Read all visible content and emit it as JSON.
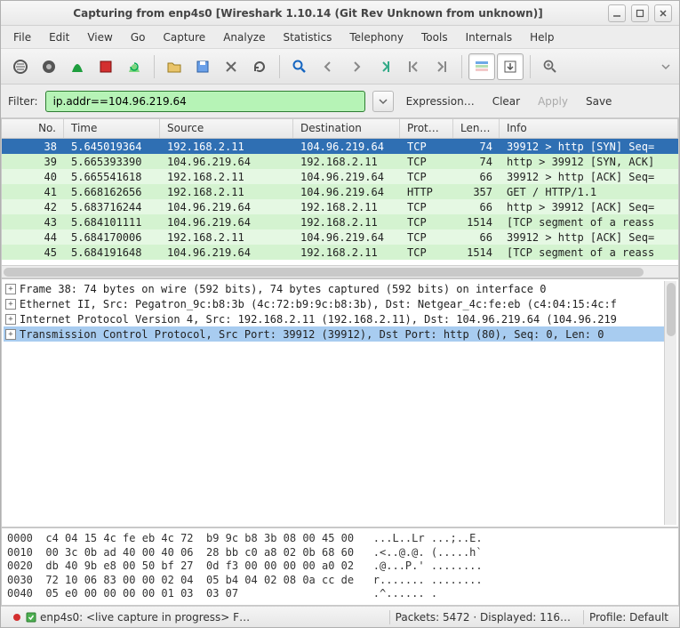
{
  "window": {
    "title": "Capturing from enp4s0   [Wireshark 1.10.14  (Git Rev Unknown from unknown)]"
  },
  "menus": [
    "File",
    "Edit",
    "View",
    "Go",
    "Capture",
    "Analyze",
    "Statistics",
    "Telephony",
    "Tools",
    "Internals",
    "Help"
  ],
  "filter": {
    "label": "Filter:",
    "value": "ip.addr==104.96.219.64",
    "expression": "Expression…",
    "clear": "Clear",
    "apply": "Apply",
    "save": "Save"
  },
  "columns": {
    "no": "No.",
    "time": "Time",
    "src": "Source",
    "dst": "Destination",
    "proto": "Protocol",
    "len": "Length",
    "info": "Info"
  },
  "packets": [
    {
      "no": 38,
      "time": "5.645019364",
      "src": "192.168.2.11",
      "dst": "104.96.219.64",
      "proto": "TCP",
      "len": 74,
      "info": "39912 > http [SYN] Seq=",
      "cls": "sel"
    },
    {
      "no": 39,
      "time": "5.665393390",
      "src": "104.96.219.64",
      "dst": "192.168.2.11",
      "proto": "TCP",
      "len": 74,
      "info": "http > 39912 [SYN, ACK]",
      "cls": "e2"
    },
    {
      "no": 40,
      "time": "5.665541618",
      "src": "192.168.2.11",
      "dst": "104.96.219.64",
      "proto": "TCP",
      "len": 66,
      "info": "39912 > http [ACK] Seq=",
      "cls": "e1"
    },
    {
      "no": 41,
      "time": "5.668162656",
      "src": "192.168.2.11",
      "dst": "104.96.219.64",
      "proto": "HTTP",
      "len": 357,
      "info": "GET / HTTP/1.1",
      "cls": "e2"
    },
    {
      "no": 42,
      "time": "5.683716244",
      "src": "104.96.219.64",
      "dst": "192.168.2.11",
      "proto": "TCP",
      "len": 66,
      "info": "http > 39912 [ACK] Seq=",
      "cls": "e1"
    },
    {
      "no": 43,
      "time": "5.684101111",
      "src": "104.96.219.64",
      "dst": "192.168.2.11",
      "proto": "TCP",
      "len": 1514,
      "info": "[TCP segment of a reass",
      "cls": "e2"
    },
    {
      "no": 44,
      "time": "5.684170006",
      "src": "192.168.2.11",
      "dst": "104.96.219.64",
      "proto": "TCP",
      "len": 66,
      "info": "39912 > http [ACK] Seq=",
      "cls": "e1"
    },
    {
      "no": 45,
      "time": "5.684191648",
      "src": "104.96.219.64",
      "dst": "192.168.2.11",
      "proto": "TCP",
      "len": 1514,
      "info": "[TCP segment of a reass",
      "cls": "e2"
    }
  ],
  "details": [
    "Frame 38: 74 bytes on wire (592 bits), 74 bytes captured (592 bits) on interface 0",
    "Ethernet II, Src: Pegatron_9c:b8:3b (4c:72:b9:9c:b8:3b), Dst: Netgear_4c:fe:eb (c4:04:15:4c:f",
    "Internet Protocol Version 4, Src: 192.168.2.11 (192.168.2.11), Dst: 104.96.219.64 (104.96.219",
    "Transmission Control Protocol, Src Port: 39912 (39912), Dst Port: http (80), Seq: 0, Len: 0"
  ],
  "bytes": [
    {
      "off": "0000",
      "hex": "c4 04 15 4c fe eb 4c 72  b9 9c b8 3b 08 00 45 00",
      "asc": "...L..Lr ...;..E."
    },
    {
      "off": "0010",
      "hex": "00 3c 0b ad 40 00 40 06  28 bb c0 a8 02 0b 68 60",
      "asc": ".<..@.@. (.....h`"
    },
    {
      "off": "0020",
      "hex": "db 40 9b e8 00 50 bf 27  0d f3 00 00 00 00 a0 02",
      "asc": ".@...P.' ........"
    },
    {
      "off": "0030",
      "hex": "72 10 06 83 00 00 02 04  05 b4 04 02 08 0a cc de",
      "asc": "r....... ........"
    },
    {
      "off": "0040",
      "hex": "05 e0 00 00 00 00 01 03  03 07                  ",
      "asc": ".^...... ."
    }
  ],
  "status": {
    "iface": "enp4s0: <live capture in progress> F…",
    "packets": "Packets: 5472 · Displayed: 116…",
    "profile": "Profile: Default"
  }
}
